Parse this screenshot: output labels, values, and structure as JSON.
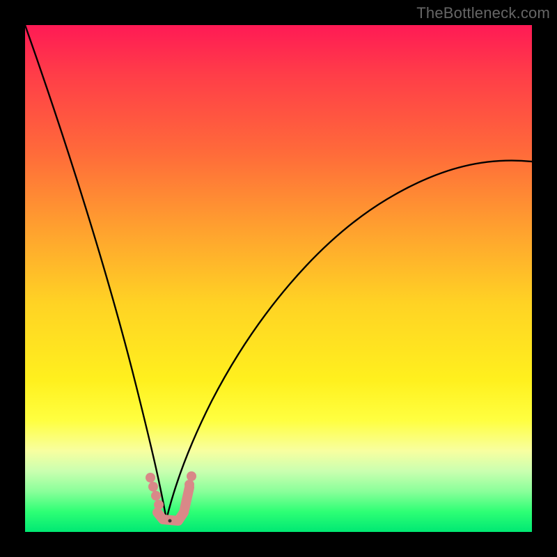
{
  "watermark": "TheBottleneck.com",
  "colors": {
    "frame": "#000000",
    "gradient_top": "#ff1a55",
    "gradient_bottom": "#00e873",
    "curve": "#000000",
    "marker": "#d98888"
  },
  "chart_data": {
    "type": "line",
    "title": "",
    "xlabel": "",
    "ylabel": "",
    "xlim": [
      0,
      100
    ],
    "ylim": [
      0,
      100
    ],
    "grid": false,
    "legend": false,
    "annotations": [
      {
        "text": "TheBottleneck.com",
        "position": "top-right"
      }
    ],
    "series": [
      {
        "name": "bottleneck-curve",
        "x": [
          0,
          2,
          4,
          6,
          8,
          10,
          12,
          14,
          16,
          18,
          20,
          22,
          24,
          26,
          27,
          28,
          30,
          32,
          34,
          36,
          40,
          45,
          50,
          55,
          60,
          65,
          70,
          75,
          80,
          85,
          90,
          95,
          100
        ],
        "y": [
          100,
          93,
          86,
          79,
          72,
          65,
          58,
          51,
          44,
          37,
          30,
          23,
          16,
          9,
          4,
          2,
          3,
          6,
          10,
          14,
          22,
          31,
          39,
          46,
          52,
          57,
          61,
          64,
          67,
          69,
          71,
          72,
          73
        ]
      }
    ],
    "optimum": {
      "x": 28,
      "y": 2
    },
    "marker_region": {
      "x_start": 24,
      "x_end": 31
    }
  }
}
